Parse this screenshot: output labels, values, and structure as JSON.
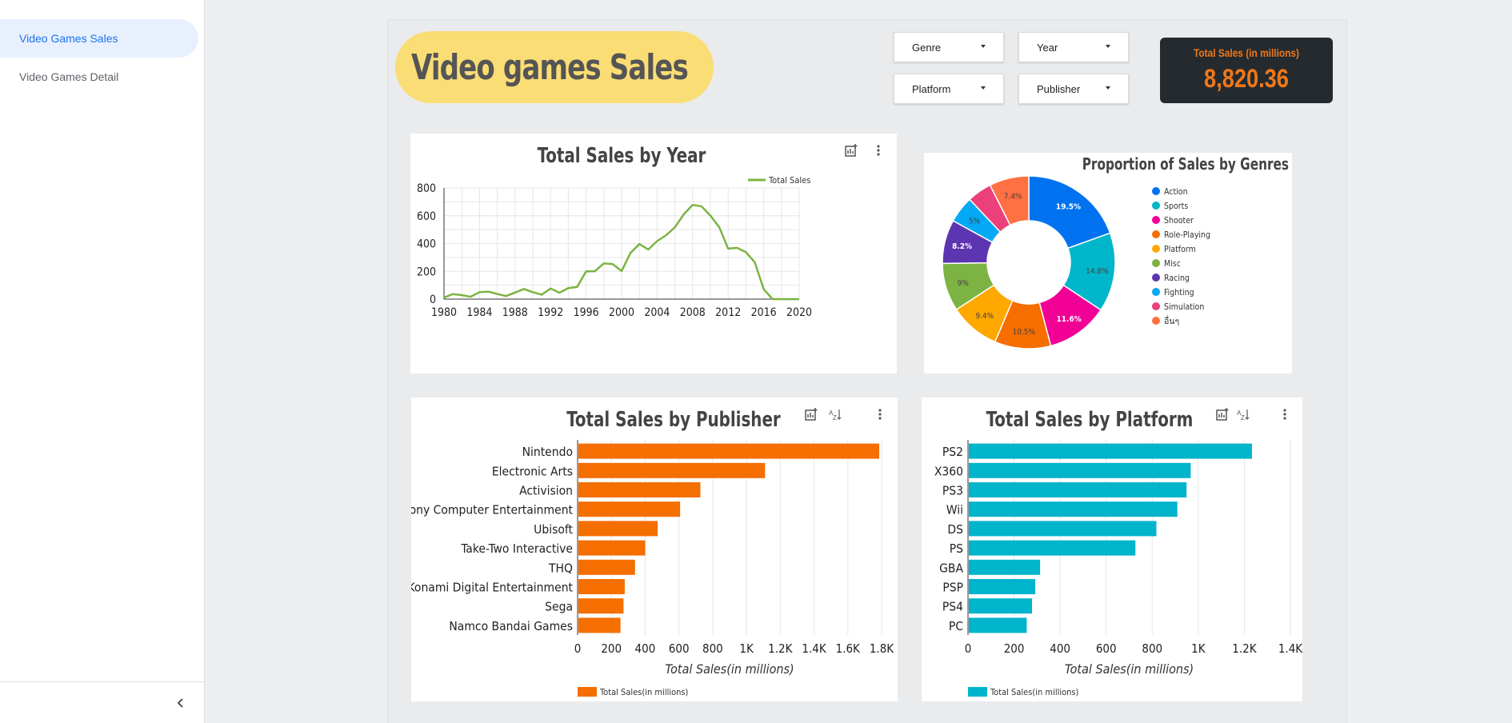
{
  "sidebar": {
    "items": [
      {
        "label": "Video Games Sales",
        "active": true
      },
      {
        "label": "Video Games Detail",
        "active": false
      }
    ]
  },
  "report": {
    "title": "Video games Sales",
    "filters": {
      "genre": "Genre",
      "year": "Year",
      "platform": "Platform",
      "publisher": "Publisher"
    },
    "scorecard": {
      "label": "Total Sales (in millions)",
      "value": "8,820.36"
    }
  },
  "colors": {
    "title_pill": "#fadd74",
    "scorecard_bg": "#252a2e",
    "scorecard_text": "#f07818",
    "line": "#7cb342",
    "publisher_bar": "#f46e00",
    "platform_bar": "#00b4cc"
  },
  "icons": {
    "panel_tools": [
      "explore-chart-icon",
      "sort-icon",
      "more-vert-icon"
    ],
    "sidebar_footer": "chevron-left-icon"
  },
  "chart_data": [
    {
      "type": "line",
      "title": "Total Sales by Year",
      "legend": "Total Sales",
      "legend_position": "top-right",
      "grid": true,
      "x": [
        1980,
        1981,
        1982,
        1983,
        1984,
        1985,
        1986,
        1987,
        1988,
        1989,
        1990,
        1991,
        1992,
        1993,
        1994,
        1995,
        1996,
        1997,
        1998,
        1999,
        2000,
        2001,
        2002,
        2003,
        2004,
        2005,
        2006,
        2007,
        2008,
        2009,
        2010,
        2011,
        2012,
        2013,
        2014,
        2015,
        2016,
        2017,
        2018,
        2019,
        2020
      ],
      "series": [
        {
          "name": "Total Sales",
          "values": [
            11,
            36,
            29,
            17,
            50,
            54,
            37,
            22,
            47,
            73,
            50,
            32,
            76,
            46,
            79,
            88,
            199,
            201,
            257,
            252,
            202,
            332,
            396,
            357,
            418,
            459,
            517,
            610,
            678,
            668,
            601,
            517,
            363,
            369,
            338,
            265,
            72,
            0,
            0,
            0,
            0
          ]
        }
      ],
      "xlim": [
        1980,
        2020
      ],
      "ylim": [
        0,
        800
      ],
      "xticks": [
        "1980",
        "1984",
        "1988",
        "1992",
        "1996",
        "2000",
        "2004",
        "2008",
        "2012",
        "2016",
        "2020"
      ],
      "yticks": [
        "0",
        "200",
        "400",
        "600",
        "800"
      ]
    },
    {
      "type": "pie",
      "title": "Proportion of Sales by Genres",
      "legend_position": "right",
      "categories": [
        "Action",
        "Sports",
        "Shooter",
        "Role-Playing",
        "Platform",
        "Misc",
        "Racing",
        "Fighting",
        "Simulation",
        "อื่นๆ"
      ],
      "values": [
        19.5,
        14.8,
        11.6,
        10.5,
        9.4,
        9.0,
        8.2,
        5.0,
        4.6,
        7.4
      ],
      "labels": [
        "19.5%",
        "14.8%",
        "11.6%",
        "10.5%",
        "9.4%",
        "9%",
        "8.2%",
        "5%",
        "",
        "7.4%"
      ],
      "colors": [
        "#0072f0",
        "#00b6cb",
        "#f10096",
        "#f66d00",
        "#ffa800",
        "#7cb342",
        "#5e35b1",
        "#03a9f4",
        "#ec407a",
        "#ff7043"
      ]
    },
    {
      "type": "bar",
      "orientation": "horizontal",
      "title": "Total Sales by Publisher",
      "xlabel": "Total Sales(in millions)",
      "legend": "Total Sales(in millions)",
      "legend_position": "bottom-left",
      "categories": [
        "Nintendo",
        "Electronic Arts",
        "Activision",
        "Sony Computer Entertainment",
        "Ubisoft",
        "Take-Two Interactive",
        "THQ",
        "Konami Digital Entertainment",
        "Sega",
        "Namco Bandai Games"
      ],
      "values": [
        1786,
        1110,
        727,
        607,
        474,
        400,
        340,
        279,
        272,
        254
      ],
      "xlim": [
        0,
        1800
      ],
      "xticks": [
        "0",
        "200",
        "400",
        "600",
        "800",
        "1K",
        "1.2K",
        "1.4K",
        "1.6K",
        "1.8K"
      ]
    },
    {
      "type": "bar",
      "orientation": "horizontal",
      "title": "Total Sales by Platform",
      "xlabel": "Total Sales(in millions)",
      "legend": "Total Sales(in millions)",
      "legend_position": "bottom-left",
      "categories": [
        "PS2",
        "X360",
        "PS3",
        "Wii",
        "DS",
        "PS",
        "GBA",
        "PSP",
        "PS4",
        "PC"
      ],
      "values": [
        1233,
        967,
        949,
        909,
        818,
        727,
        313,
        292,
        278,
        255
      ],
      "xlim": [
        0,
        1400
      ],
      "xticks": [
        "0",
        "200",
        "400",
        "600",
        "800",
        "1K",
        "1.2K",
        "1.4K"
      ]
    }
  ]
}
